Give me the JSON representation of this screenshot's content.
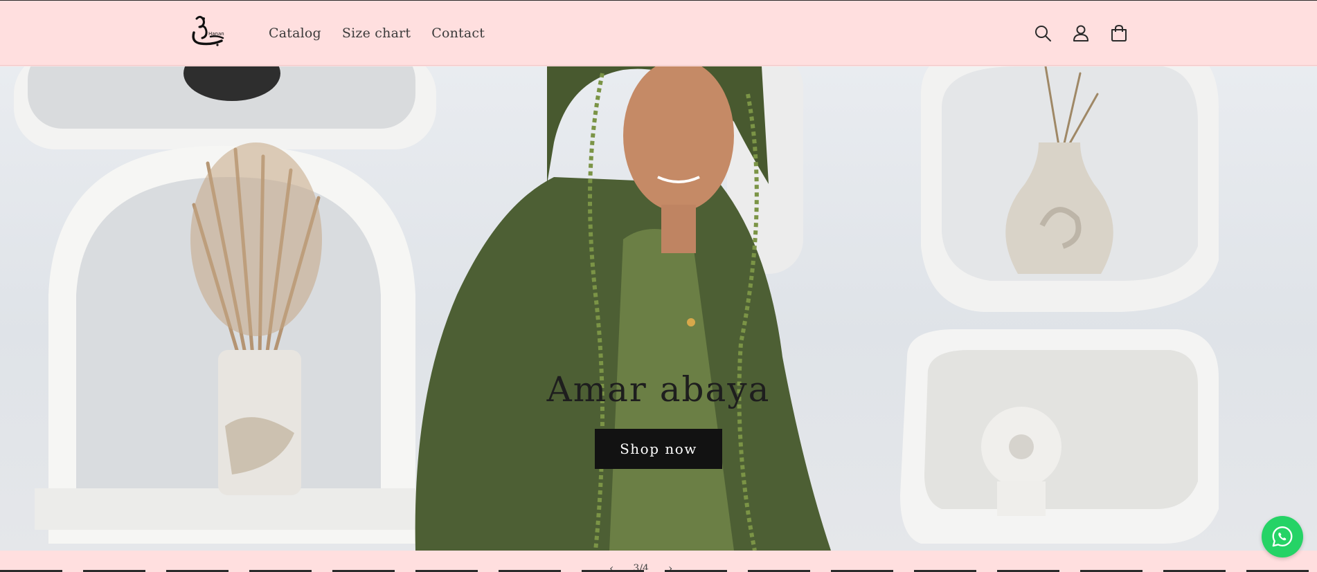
{
  "brand": {
    "logo_icon": "hanan-calligraphy-logo",
    "logo_text": "Hanan"
  },
  "nav": {
    "items": [
      {
        "label": "Catalog"
      },
      {
        "label": "Size chart"
      },
      {
        "label": "Contact"
      }
    ]
  },
  "header_icons": {
    "search": "search-icon",
    "account": "account-icon",
    "cart": "cart-icon"
  },
  "hero": {
    "title": "Amar abaya",
    "button_label": "Shop now"
  },
  "slideshow": {
    "counter": "3/4",
    "prev": "‹",
    "next": "›"
  },
  "floating": {
    "whatsapp": "whatsapp-icon"
  },
  "colors": {
    "header_bg": "#ffdfdf",
    "button_bg": "#121212",
    "button_text": "#ffffff",
    "whatsapp": "#25d366",
    "abaya_green": "#556b3a"
  }
}
